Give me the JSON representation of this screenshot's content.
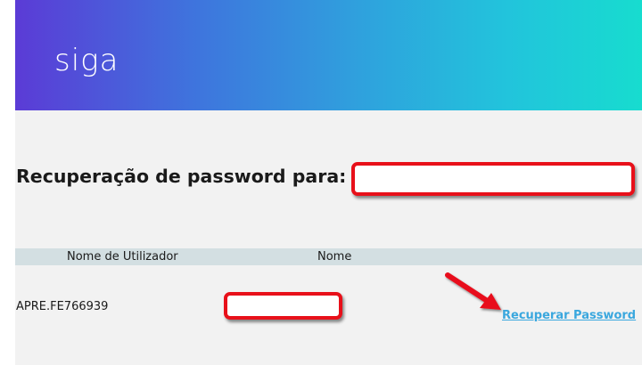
{
  "header": {
    "logo_text": "siga",
    "gradient": [
      "#5b3bd6",
      "#2fa1dd",
      "#17dccf"
    ]
  },
  "main": {
    "heading": "Recuperação de password para:",
    "table": {
      "columns": [
        "Nome de Utilizador",
        "Nome"
      ],
      "rows": [
        {
          "username": "APRE.FE766939",
          "action_label": "Recuperar Password"
        }
      ]
    }
  },
  "colors": {
    "panel_bg": "#f2f2f2",
    "table_header_bg": "#d3dfe2",
    "link": "#3aa7de",
    "annotation_red": "#e8101a"
  },
  "annotations": {
    "arrow_icon": "red-arrow-icon"
  }
}
